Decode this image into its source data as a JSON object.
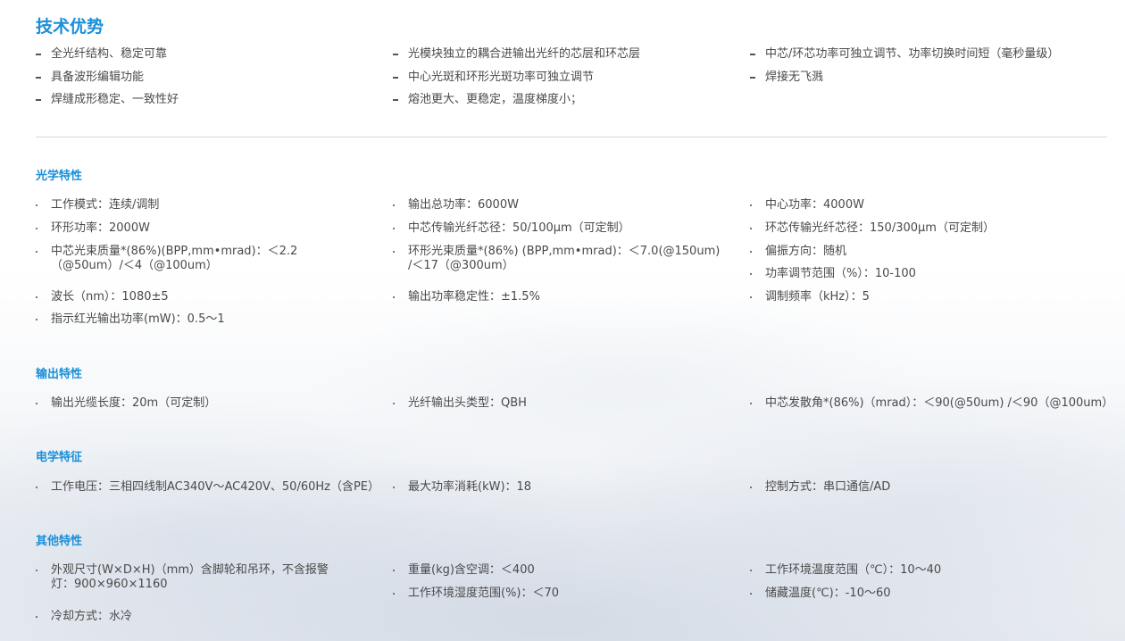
{
  "advantages": {
    "title": "技术优势",
    "columns": [
      [
        "全光纤结构、稳定可靠",
        "具备波形编辑功能",
        "焊缝成形稳定、一致性好"
      ],
      [
        "光模块独立的耦合进输出光纤的芯层和环芯层",
        "中心光斑和环形光斑功率可独立调节",
        "熔池更大、更稳定，温度梯度小；"
      ],
      [
        "中芯/环芯功率可独立调节、功率切换时间短（毫秒量级）",
        "焊接无飞溅"
      ]
    ]
  },
  "optical": {
    "title": "光学特性",
    "items": [
      "工作模式：连续/调制",
      "输出总功率：6000W",
      "中心功率：4000W",
      "环形功率：2000W",
      "中芯传输光纤芯径：50/100μm（可定制）",
      "环芯传输光纤芯径：150/300μm（可定制）",
      "中芯光束质量*(86%)(BPP,mm•mrad)：＜2.2（@50um）/＜4（@100um）",
      "环形光束质量*(86%) (BPP,mm•mrad)：＜7.0(@150um) /＜17（@300um）",
      "偏振方向：随机",
      "功率调节范围（%）：10-100",
      "波长（nm）：1080±5",
      "输出功率稳定性：±1.5%",
      "调制频率（kHz）：5",
      "指示红光输出功率(mW)：0.5～1"
    ]
  },
  "output": {
    "title": "输出特性",
    "items": [
      "输出光缆长度：20m（可定制）",
      "光纤输出头类型：QBH",
      "中芯发散角*(86%)（mrad）：＜90(@50um) /＜90（@100um）"
    ]
  },
  "electrical": {
    "title": "电学特征",
    "items": [
      "工作电压：三相四线制AC340V～AC420V、50/60Hz（含PE）",
      "最大功率消耗(kW)：18",
      "控制方式：串口通信/AD"
    ]
  },
  "other": {
    "title": "其他特性",
    "items": [
      "外观尺寸(W×D×H)（mm）含脚轮和吊环，不含报警灯：900×960×1160",
      "重量(kg)含空调：＜400",
      "工作环境温度范围（℃）：10～40",
      "工作环境湿度范围(%)：＜70",
      "储藏温度(℃)：-10～60",
      "冷却方式：水冷"
    ]
  }
}
